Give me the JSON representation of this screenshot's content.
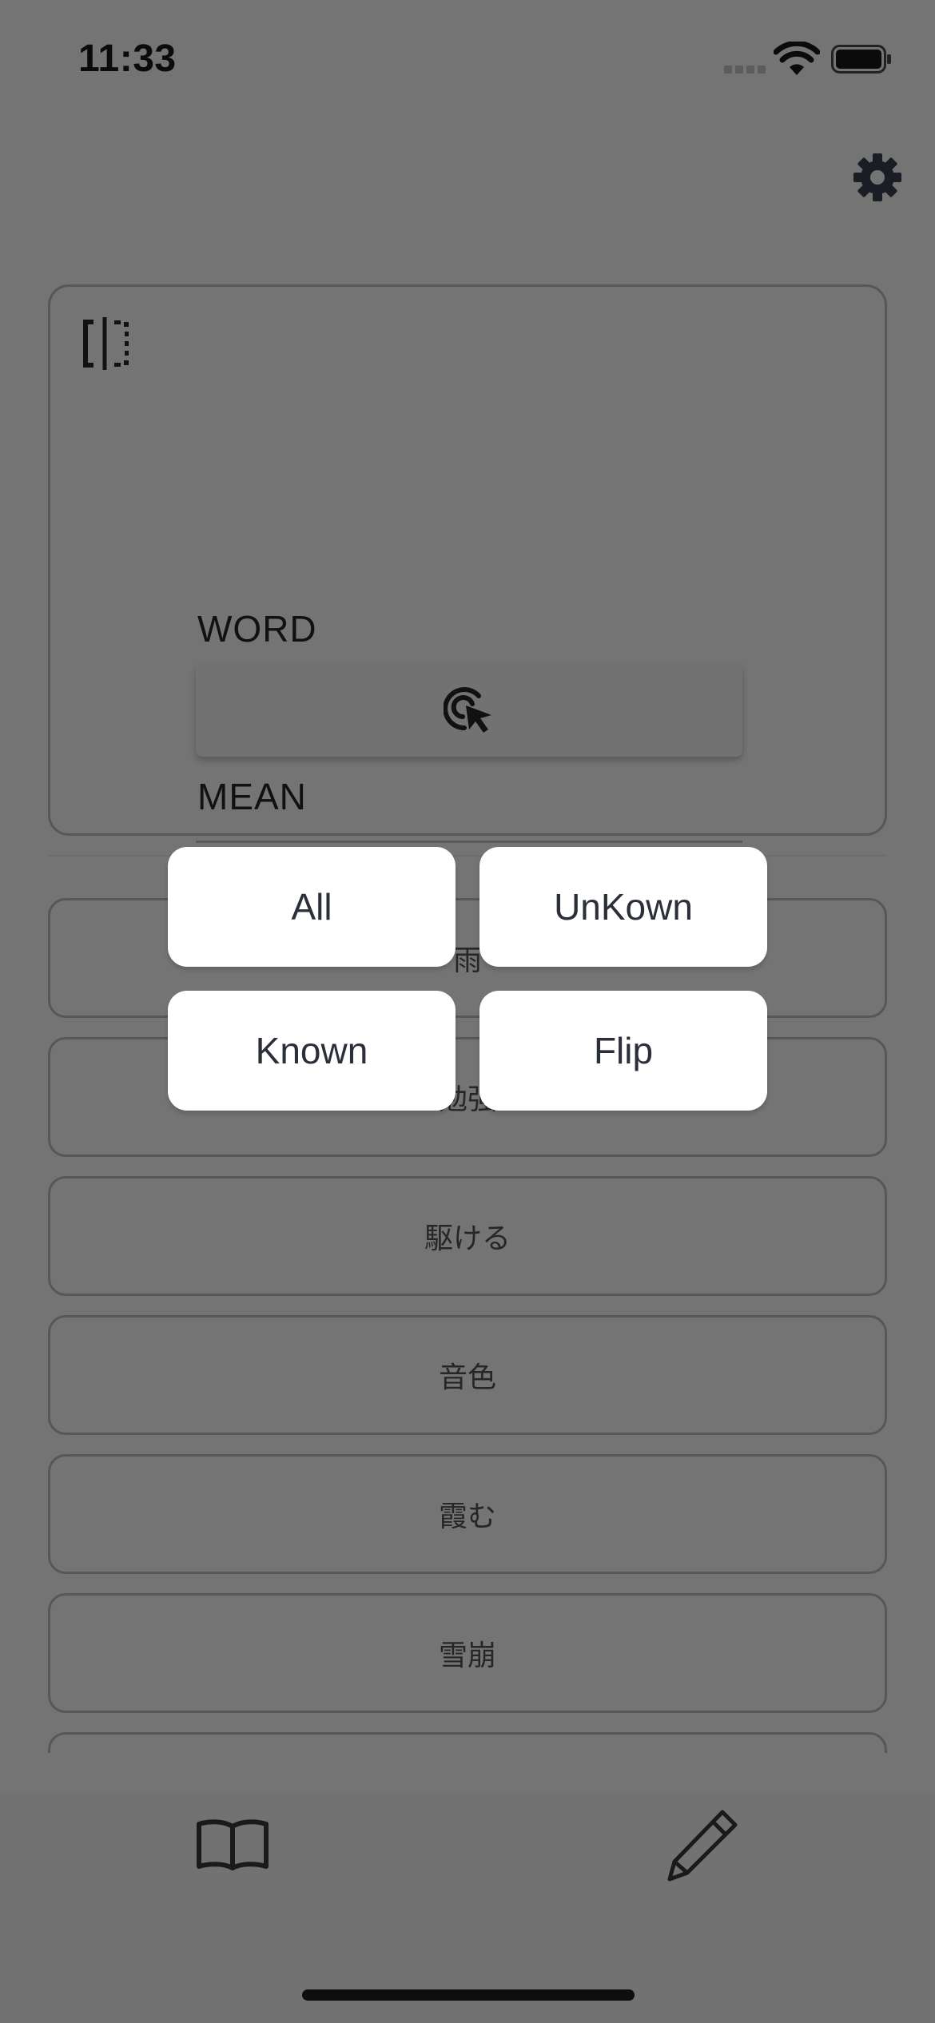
{
  "status_bar": {
    "time": "11:33"
  },
  "input_card": {
    "word_placeholder": "WORD",
    "mean_placeholder": "MEAN"
  },
  "word_list": {
    "items": [
      {
        "word": "雨"
      },
      {
        "word": "勉強"
      },
      {
        "word": "駆ける"
      },
      {
        "word": "音色"
      },
      {
        "word": "霞む"
      },
      {
        "word": "雪崩"
      },
      {
        "word": ""
      }
    ]
  },
  "filter_popup": {
    "all_label": "All",
    "unknown_label": "UnKown",
    "known_label": "Known",
    "flip_label": "Flip"
  },
  "tab_bar": {
    "tabs": [
      {
        "icon": "book-icon"
      },
      {
        "icon": "pencil-icon"
      }
    ]
  },
  "colors": {
    "overlay_background": "#747474",
    "popup_button": "#ffffff",
    "popup_text": "#2b2f3a"
  }
}
